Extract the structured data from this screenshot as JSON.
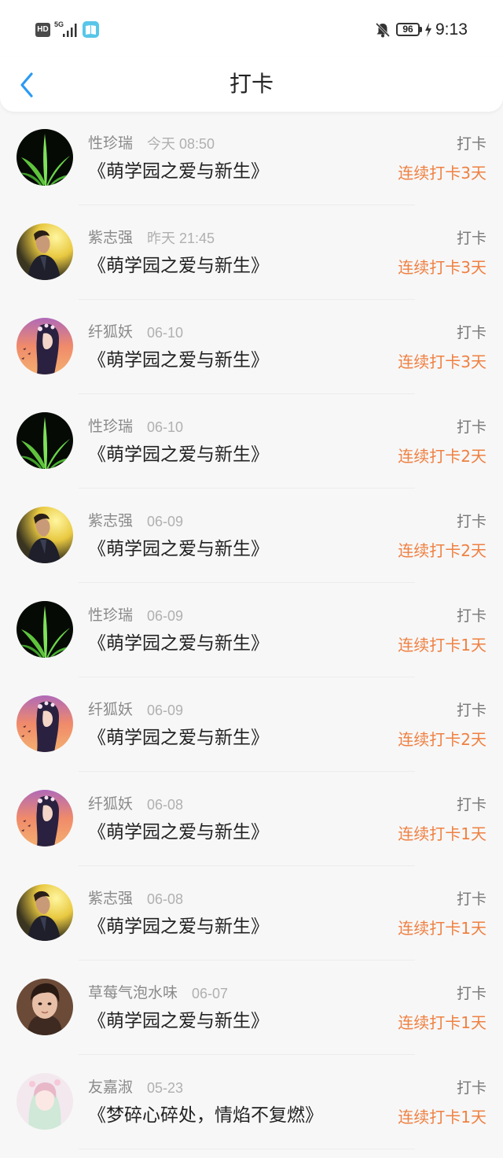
{
  "status_bar": {
    "hd": "HD",
    "network": "5G",
    "battery": "96",
    "time": "9:13"
  },
  "nav": {
    "title": "打卡",
    "back_icon": "chevron-left-icon"
  },
  "colors": {
    "accent": "#2b9af3",
    "streak": "#ef8042",
    "username": "#8a8a8a",
    "time": "#b0b0b0"
  },
  "records": [
    {
      "user": "性珍瑞",
      "time": "今天 08:50",
      "title": "《萌学园之爱与新生》",
      "action": "打卡",
      "streak": "连续打卡3天",
      "avatar": "green-plant"
    },
    {
      "user": "紫志强",
      "time": "昨天 21:45",
      "title": "《萌学园之爱与新生》",
      "action": "打卡",
      "streak": "连续打卡3天",
      "avatar": "man-yellow"
    },
    {
      "user": "纤狐妖",
      "time": "06-10",
      "title": "《萌学园之爱与新生》",
      "action": "打卡",
      "streak": "连续打卡3天",
      "avatar": "anime-girl"
    },
    {
      "user": "性珍瑞",
      "time": "06-10",
      "title": "《萌学园之爱与新生》",
      "action": "打卡",
      "streak": "连续打卡2天",
      "avatar": "green-plant"
    },
    {
      "user": "紫志强",
      "time": "06-09",
      "title": "《萌学园之爱与新生》",
      "action": "打卡",
      "streak": "连续打卡2天",
      "avatar": "man-yellow"
    },
    {
      "user": "性珍瑞",
      "time": "06-09",
      "title": "《萌学园之爱与新生》",
      "action": "打卡",
      "streak": "连续打卡1天",
      "avatar": "green-plant"
    },
    {
      "user": "纤狐妖",
      "time": "06-09",
      "title": "《萌学园之爱与新生》",
      "action": "打卡",
      "streak": "连续打卡2天",
      "avatar": "anime-girl"
    },
    {
      "user": "纤狐妖",
      "time": "06-08",
      "title": "《萌学园之爱与新生》",
      "action": "打卡",
      "streak": "连续打卡1天",
      "avatar": "anime-girl"
    },
    {
      "user": "紫志强",
      "time": "06-08",
      "title": "《萌学园之爱与新生》",
      "action": "打卡",
      "streak": "连续打卡1天",
      "avatar": "man-yellow"
    },
    {
      "user": "草莓气泡水味",
      "time": "06-07",
      "title": "《萌学园之爱与新生》",
      "action": "打卡",
      "streak": "连续打卡1天",
      "avatar": "portrait-man"
    },
    {
      "user": "友嘉淑",
      "time": "05-23",
      "title": "《梦碎心碎处，情焰不复燃》",
      "action": "打卡",
      "streak": "连续打卡1天",
      "avatar": "pastel-anime"
    }
  ]
}
